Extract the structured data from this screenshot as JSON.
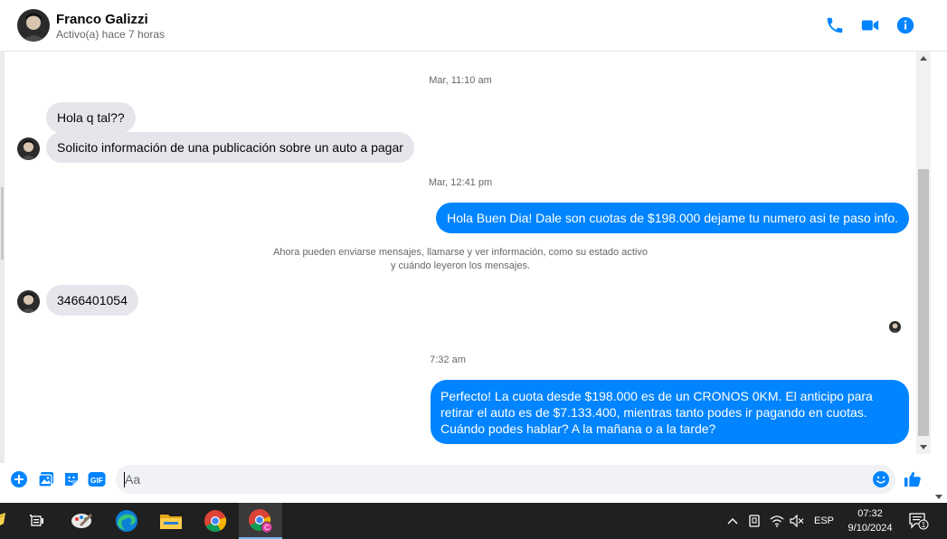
{
  "header": {
    "name": "Franco Galizzi",
    "status": "Activo(a) hace 7 horas"
  },
  "colors": {
    "accent": "#0084ff",
    "incoming_bubble": "#e4e6eb",
    "taskbar": "#202020"
  },
  "messages": {
    "ts1": "Mar, 11:10 am",
    "m1": "Hola q tal??",
    "m2": "Solicito información de una publicación sobre un auto a pagar",
    "ts2": "Mar, 12:41 pm",
    "m3": "Hola Buen Dia! Dale son cuotas de $198.000 dejame tu numero asi te paso info.",
    "notice_line1": "Ahora pueden enviarse mensajes, llamarse y ver información, como su estado activo",
    "notice_line2": "y cuándo leyeron los mensajes.",
    "m4": "3466401054",
    "ts3": "7:32 am",
    "m5": "Perfecto! La cuota desde $198.000 es de un CRONOS 0KM. El anticipo para retirar el auto es de $7.133.400, mientras tanto podes ir pagando en cuotas. Cuándo podes hablar? A la mañana o a la tarde?"
  },
  "composer": {
    "placeholder": "Aa",
    "gif_label": "GIF"
  },
  "taskbar": {
    "language": "ESP",
    "time": "07:32",
    "date": "9/10/2024",
    "notification_count": "1"
  }
}
